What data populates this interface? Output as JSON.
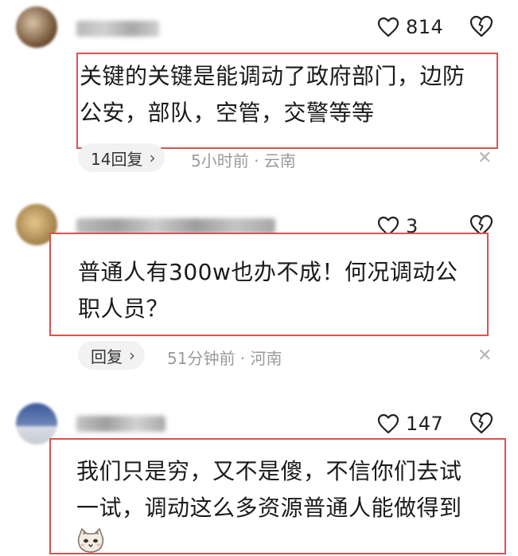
{
  "comments": [
    {
      "like_count": "814",
      "text_lines": [
        "关键的关键是能调动了政府部门，边防",
        "公安，部队，空管，交警等等"
      ],
      "reply_label": "14回复",
      "meta": "5小时前 · 云南",
      "chevron": "›",
      "dismiss": "✕"
    },
    {
      "like_count": "3",
      "text_lines": [
        "普通人有300w也办不成！何况调动公",
        "职人员？"
      ],
      "reply_label": "回复",
      "meta": "51分钟前 · 河南",
      "chevron": "›",
      "dismiss": "✕"
    },
    {
      "like_count": "147",
      "text_lines": [
        "我们只是穷，又不是傻，不信你们去试",
        "一试，调动这么多资源普通人能做得到"
      ]
    }
  ],
  "icons": {
    "like": "heart-outline-icon",
    "dislike": "broken-heart-icon",
    "close": "close-icon",
    "emoji": "cat-face-emoji"
  },
  "colors": {
    "highlight_border": "#d9534f",
    "meta_gray": "#9a9a9a",
    "pill_bg": "#f2f2f2"
  }
}
